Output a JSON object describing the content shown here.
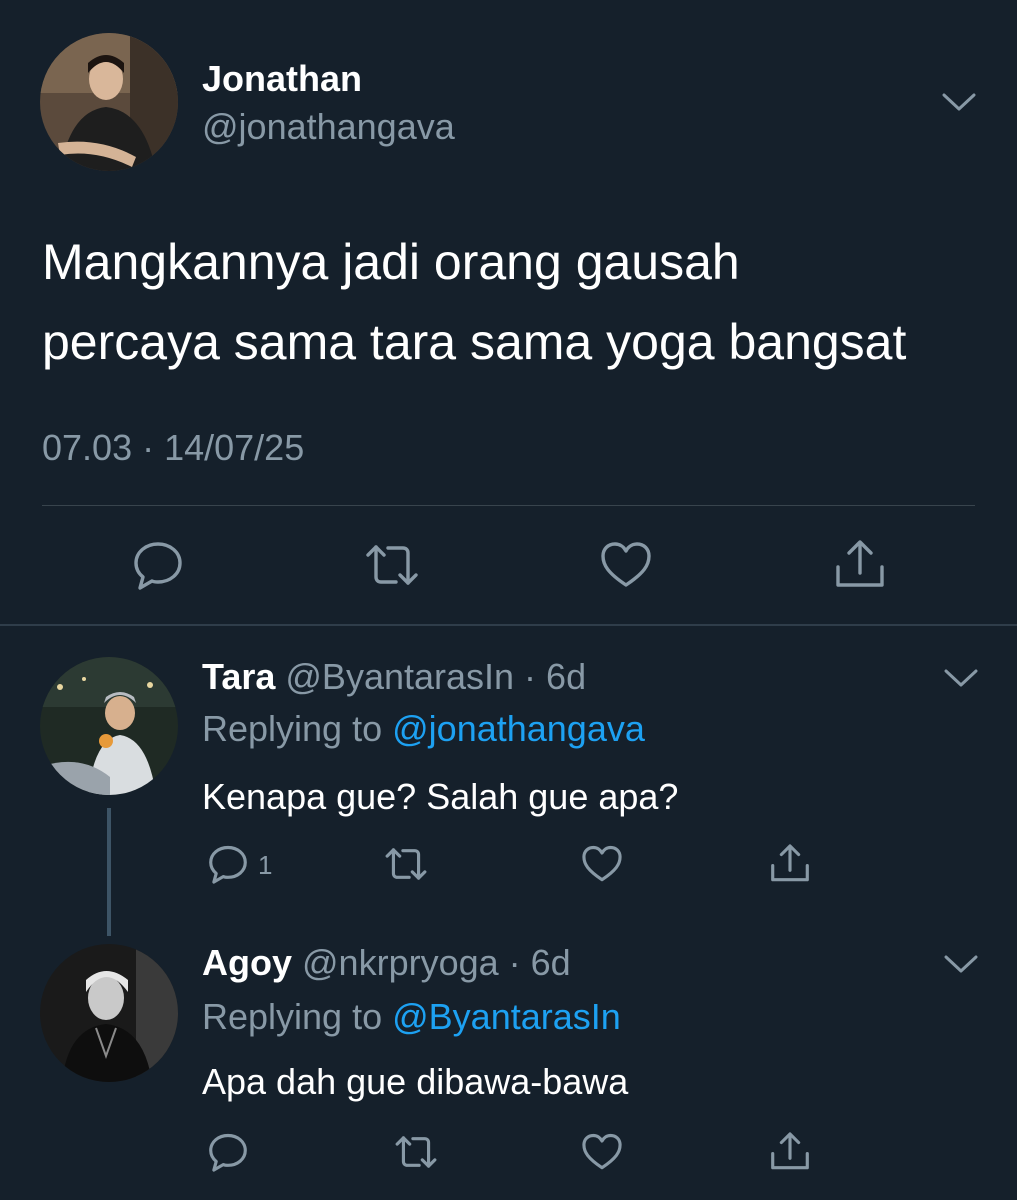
{
  "main_tweet": {
    "name": "Jonathan",
    "handle": "@jonathangava",
    "text_line1": "Mangkannya jadi orang gausah",
    "text_line2": "percaya sama tara sama yoga bangsat",
    "timestamp": "07.03 · 14/07/25",
    "actions": [
      "reply-icon",
      "retweet-icon",
      "like-icon",
      "share-icon"
    ]
  },
  "replies": [
    {
      "name": "Tara",
      "handle": "@ByantarasIn",
      "time": "6d",
      "replying_label": "Replying to",
      "replying_to": "@jonathangava",
      "text": "Kenapa gue? Salah gue apa?",
      "reply_count": "1"
    },
    {
      "name": "Agoy",
      "handle": "@nkrpryoga",
      "time": "6d",
      "replying_label": "Replying to",
      "replying_to": "@ByantarasIn",
      "text": "Apa dah gue dibawa-bawa"
    }
  ],
  "colors": {
    "background": "#15202b",
    "secondary_text": "#8899a6",
    "link": "#1da1f2"
  }
}
